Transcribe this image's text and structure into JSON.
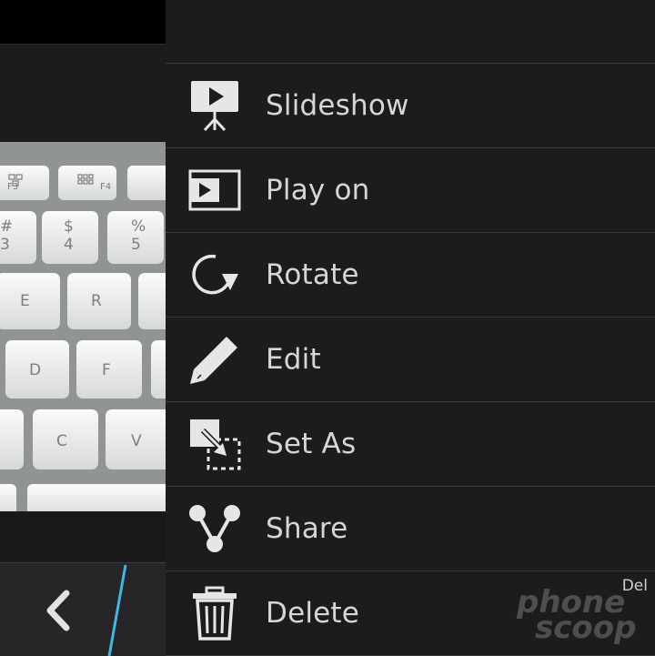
{
  "gallery": {
    "back_icon": "chevron-left-icon",
    "photo_subject": "keyboard",
    "keyboard_keys": [
      "F3",
      "F4",
      "#",
      "3",
      "$",
      "4",
      "%",
      "5",
      "E",
      "R",
      "D",
      "F",
      "C",
      "V"
    ]
  },
  "menu": {
    "items": [
      {
        "label": "Slideshow",
        "icon": "slideshow-icon"
      },
      {
        "label": "Play on",
        "icon": "play-on-icon"
      },
      {
        "label": "Rotate",
        "icon": "rotate-icon"
      },
      {
        "label": "Edit",
        "icon": "pencil-icon"
      },
      {
        "label": "Set As",
        "icon": "set-as-icon"
      },
      {
        "label": "Share",
        "icon": "share-icon"
      },
      {
        "label": "Delete",
        "icon": "trash-icon",
        "shortcut": "Del"
      }
    ]
  },
  "watermark": {
    "line1": "phone",
    "line2": "scoop"
  },
  "colors": {
    "accent": "#3fb8e8",
    "menu_background": "#1c1c1c",
    "divider": "#3a3a3a",
    "text": "#d6d6d6"
  }
}
